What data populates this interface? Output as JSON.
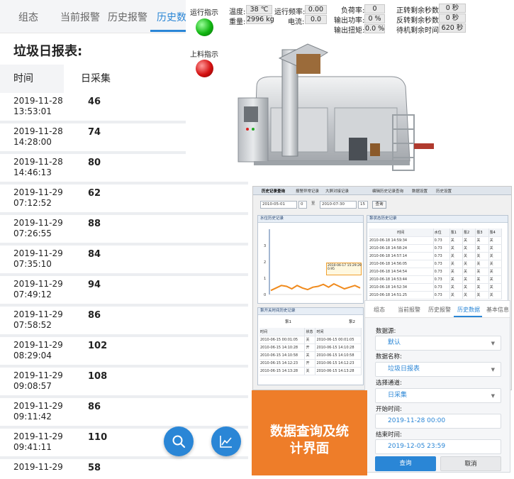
{
  "phone": {
    "tabs": [
      "组态",
      "当前报警",
      "历史报警",
      "历史数据"
    ],
    "active_tab": 3,
    "title": "垃圾日报表:",
    "columns": {
      "time": "时间",
      "value": "日采集"
    },
    "rows": [
      {
        "date": "2019-11-28",
        "time": "13:53:01",
        "value": "46"
      },
      {
        "date": "2019-11-28",
        "time": "14:28:00",
        "value": "74"
      },
      {
        "date": "2019-11-28",
        "time": "14:46:13",
        "value": "80"
      },
      {
        "date": "2019-11-29",
        "time": "07:12:52",
        "value": "62"
      },
      {
        "date": "2019-11-29",
        "time": "07:26:55",
        "value": "88"
      },
      {
        "date": "2019-11-29",
        "time": "07:35:10",
        "value": "84"
      },
      {
        "date": "2019-11-29",
        "time": "07:49:12",
        "value": "94"
      },
      {
        "date": "2019-11-29",
        "time": "07:58:52",
        "value": "86"
      },
      {
        "date": "2019-11-29",
        "time": "08:29:04",
        "value": "102"
      },
      {
        "date": "2019-11-29",
        "time": "09:08:57",
        "value": "108"
      },
      {
        "date": "2019-11-29",
        "time": "09:11:42",
        "value": "86"
      },
      {
        "date": "2019-11-29",
        "time": "09:41:11",
        "value": "110"
      },
      {
        "date": "2019-11-29",
        "time": "",
        "value": "58"
      }
    ],
    "fab_icons": [
      "search-icon",
      "line-chart-icon"
    ],
    "accent": "#2a86d6"
  },
  "machine": {
    "run_indicator_label": "运行指示",
    "run_indicator_color": "#11b511",
    "feed_indicator_label": "上料指示",
    "feed_indicator_color": "#d41010",
    "params": {
      "temp_label": "温度:",
      "temp_value": "38 ℃",
      "weight_label": "重量:",
      "weight_value": "2996 kg",
      "freq_label": "运行频率:",
      "freq_value": "0.00",
      "current_label": "电流:",
      "current_value": "0.0",
      "load_label": "负荷率:",
      "load_value": "0",
      "power_label": "输出功率:",
      "power_value": "0 %",
      "torque_label": "输出扭矩:",
      "torque_value": "0.0 %",
      "fwd_label": "正转剩余秒数:",
      "fwd_value": "0 秒",
      "rev_label": "反转剩余秒数:",
      "rev_value": "0 秒",
      "standby_label": "待机剩余时间:",
      "standby_value": "620 秒"
    }
  },
  "screenshot": {
    "tabs": [
      "历史记录查询",
      "报警异常记录",
      "大屏对接记录",
      "编辑历史记录查询",
      "数据设置",
      "历史设置"
    ],
    "start_date": "2010-05-01",
    "start_hour": "0",
    "separator": "至",
    "end_date": "2010-07-30",
    "end_hour": "15",
    "query_label": "查询",
    "chart_panel_title": "水位历史记录",
    "table_panel_title": "泵状态历史记录",
    "switch_panel_title": "泵开关时间历史记录",
    "table_headers": [
      "时间",
      "水位",
      "泵1",
      "泵2",
      "泵3",
      "泵4"
    ],
    "table_rows": [
      [
        "2010-06-18 14:59:34",
        "0.73",
        "关",
        "关",
        "关",
        "关"
      ],
      [
        "2010-06-18 14:58:24",
        "0.73",
        "关",
        "关",
        "关",
        "关"
      ],
      [
        "2010-06-18 14:57:14",
        "0.73",
        "关",
        "关",
        "关",
        "关"
      ],
      [
        "2010-06-18 14:56:05",
        "0.73",
        "关",
        "关",
        "关",
        "关"
      ],
      [
        "2010-06-18 14:54:54",
        "0.73",
        "关",
        "关",
        "关",
        "关"
      ],
      [
        "2010-06-18 14:53:44",
        "0.73",
        "关",
        "关",
        "关",
        "关"
      ],
      [
        "2010-06-18 14:52:34",
        "0.73",
        "关",
        "关",
        "关",
        "关"
      ],
      [
        "2010-06-18 14:51:25",
        "0.73",
        "关",
        "关",
        "关",
        "关"
      ]
    ],
    "switch_groups": [
      "泵1",
      "泵2"
    ],
    "switch_headers": [
      "时间",
      "状态",
      "时间"
    ],
    "switch_rows": [
      [
        "2010-06-15 00:01:05",
        "关",
        "2010-06-15 00:01:05"
      ],
      [
        "2010-06-15 14:10:28",
        "开",
        "2010-06-15 14:10:28"
      ],
      [
        "2010-06-15 14:10:58",
        "关",
        "2010-06-15 14:10:58"
      ],
      [
        "2010-06-15 14:12:23",
        "开",
        "2010-06-15 14:12:23"
      ],
      [
        "2010-06-15 14:13:28",
        "关",
        "2010-06-15 14:13:28"
      ]
    ],
    "chart_tooltip_time": "2010-06-17 15:29:29",
    "chart_tooltip_value": "0.95",
    "chart_y_ticks": [
      "3",
      "2",
      "1",
      "0"
    ],
    "chart_series": [
      0.25,
      0.4,
      0.55,
      0.5,
      0.35,
      0.55,
      0.4,
      0.3,
      0.45,
      0.5,
      0.62,
      0.45,
      0.65,
      0.5,
      0.35,
      0.45,
      0.55,
      0.4
    ],
    "chart_y_max": 4,
    "line_color": "#f08a1c"
  },
  "form": {
    "tabs": [
      "组态",
      "当前报警",
      "历史报警",
      "历史数据",
      "基本信息"
    ],
    "active_tab": 3,
    "source_label": "数据源:",
    "source_value": "默认",
    "name_label": "数据名称:",
    "name_value": "垃圾日报表",
    "channel_label": "选择通道:",
    "channel_value": "日采集",
    "start_label": "开始时间:",
    "start_value": "2019-11-28 00:00",
    "end_label": "结束时间:",
    "end_value": "2019-12-05 23:59",
    "query_button": "查询",
    "cancel_button": "取消",
    "query_color": "#2a86d6"
  },
  "caption": {
    "line1": "数据查询及统",
    "line2": "计界面",
    "color": "#ee7d29"
  }
}
